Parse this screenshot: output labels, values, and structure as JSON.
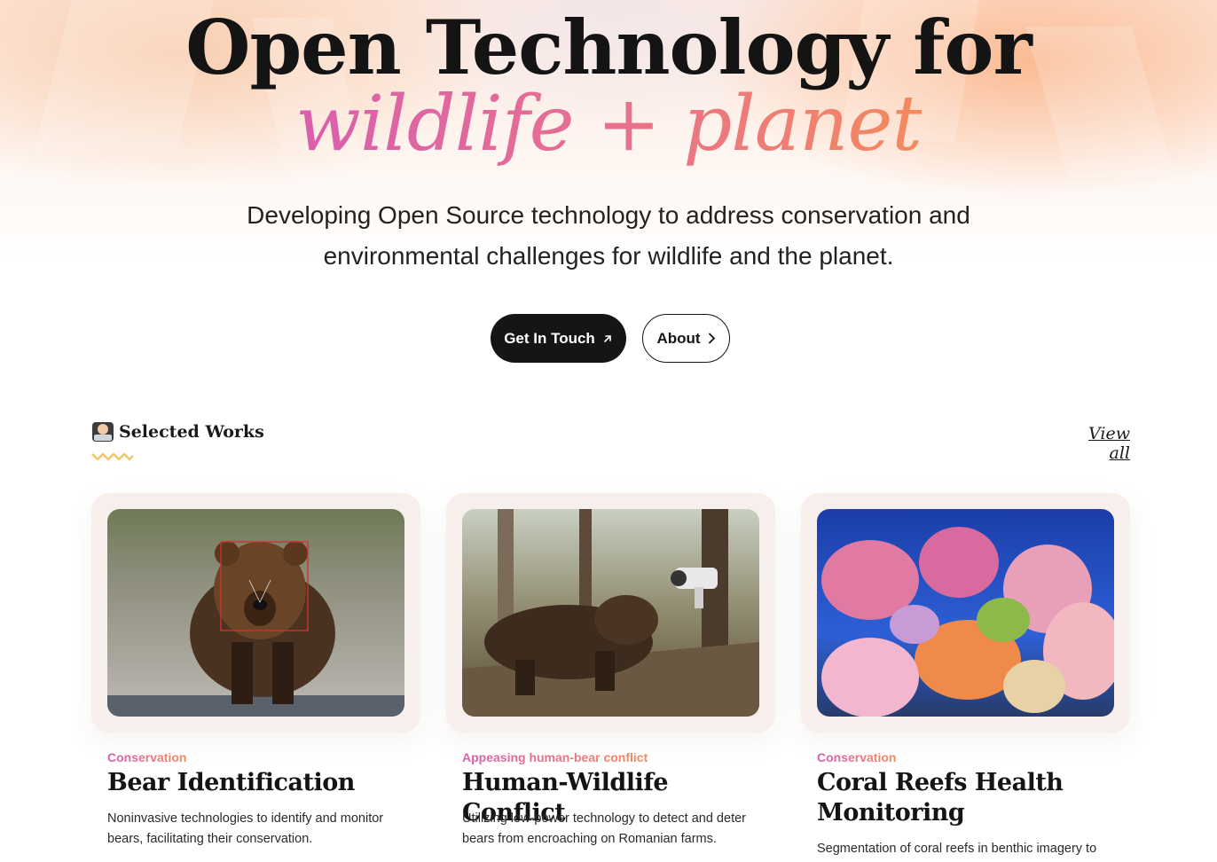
{
  "hero": {
    "title_line1": "Open Technology for",
    "title_accent": "wildlife + planet",
    "subtitle": "Developing Open Source technology to address conservation and environmental challenges for wildlife and the planet.",
    "accent_gradient": [
      "#d95fae",
      "#f48a5e"
    ]
  },
  "actions": {
    "primary_label": "Get In Touch",
    "primary_icon": "arrow-up-right-icon",
    "secondary_label": "About",
    "secondary_icon": "chevron-right-icon"
  },
  "works": {
    "section_icon": "technologist-emoji-icon",
    "section_title": "Selected Works",
    "view_all_label": "View all",
    "items": [
      {
        "category": "Conservation",
        "title": "Bear Identification",
        "description": "Noninvasive technologies to identify and monitor bears, facilitating their conservation.",
        "image": "brown bear with face detection box"
      },
      {
        "category": "Appeasing human-bear conflict",
        "title": "Human-Wildlife Conflict",
        "description": "Utilizing low-power technology to detect and deter bears from encroaching on Romanian farms.",
        "image": "bear near security camera in forest"
      },
      {
        "category": "Conservation",
        "title": "Coral Reefs Health Monitoring",
        "description": "Segmentation of coral reefs in benthic imagery to",
        "image": "colorful coral reef"
      }
    ]
  },
  "colors": {
    "text": "#141414",
    "button_dark": "#151515",
    "card_bg": "#f7efec",
    "detection_box": "#d32f2f"
  }
}
